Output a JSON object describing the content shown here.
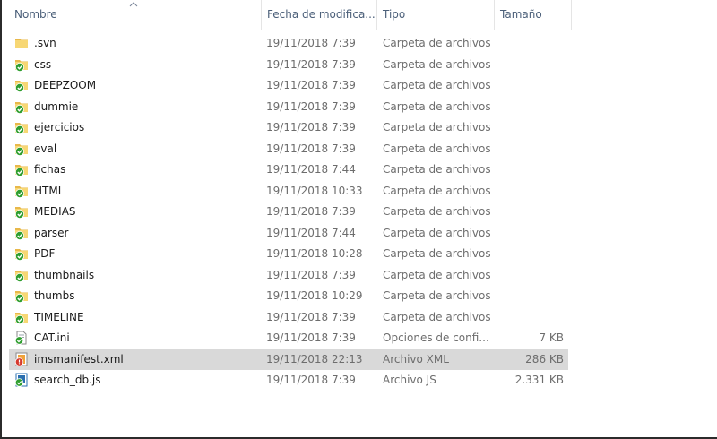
{
  "columns": {
    "name": "Nombre",
    "date": "Fecha de modifica...",
    "type": "Tipo",
    "size": "Tamaño"
  },
  "rows": [
    {
      "name": ".svn",
      "date": "19/11/2018 7:39",
      "type": "Carpeta de archivos",
      "size": "",
      "icon": "folder-icon"
    },
    {
      "name": "css",
      "date": "19/11/2018 7:39",
      "type": "Carpeta de archivos",
      "size": "",
      "icon": "folder-synced-icon"
    },
    {
      "name": "DEEPZOOM",
      "date": "19/11/2018 7:39",
      "type": "Carpeta de archivos",
      "size": "",
      "icon": "folder-synced-icon"
    },
    {
      "name": "dummie",
      "date": "19/11/2018 7:39",
      "type": "Carpeta de archivos",
      "size": "",
      "icon": "folder-synced-icon"
    },
    {
      "name": "ejercicios",
      "date": "19/11/2018 7:39",
      "type": "Carpeta de archivos",
      "size": "",
      "icon": "folder-synced-icon"
    },
    {
      "name": "eval",
      "date": "19/11/2018 7:39",
      "type": "Carpeta de archivos",
      "size": "",
      "icon": "folder-synced-icon"
    },
    {
      "name": "fichas",
      "date": "19/11/2018 7:44",
      "type": "Carpeta de archivos",
      "size": "",
      "icon": "folder-synced-icon"
    },
    {
      "name": "HTML",
      "date": "19/11/2018 10:33",
      "type": "Carpeta de archivos",
      "size": "",
      "icon": "folder-synced-icon"
    },
    {
      "name": "MEDIAS",
      "date": "19/11/2018 7:39",
      "type": "Carpeta de archivos",
      "size": "",
      "icon": "folder-synced-icon"
    },
    {
      "name": "parser",
      "date": "19/11/2018 7:44",
      "type": "Carpeta de archivos",
      "size": "",
      "icon": "folder-synced-icon"
    },
    {
      "name": "PDF",
      "date": "19/11/2018 10:28",
      "type": "Carpeta de archivos",
      "size": "",
      "icon": "folder-synced-icon"
    },
    {
      "name": "thumbnails",
      "date": "19/11/2018 7:39",
      "type": "Carpeta de archivos",
      "size": "",
      "icon": "folder-synced-icon"
    },
    {
      "name": "thumbs",
      "date": "19/11/2018 10:29",
      "type": "Carpeta de archivos",
      "size": "",
      "icon": "folder-synced-icon"
    },
    {
      "name": "TIMELINE",
      "date": "19/11/2018 7:39",
      "type": "Carpeta de archivos",
      "size": "",
      "icon": "folder-synced-icon"
    },
    {
      "name": "CAT.ini",
      "date": "19/11/2018 7:39",
      "type": "Opciones de confi...",
      "size": "7 KB",
      "icon": "ini-file-synced-icon"
    },
    {
      "name": "imsmanifest.xml",
      "date": "19/11/2018 22:13",
      "type": "Archivo XML",
      "size": "286 KB",
      "icon": "xml-file-modified-icon"
    },
    {
      "name": "search_db.js",
      "date": "19/11/2018 7:39",
      "type": "Archivo JS",
      "size": "2.331 KB",
      "icon": "js-file-synced-icon"
    }
  ],
  "selected_row": "imsmanifest.xml",
  "colors": {
    "header_text": "#4c607a",
    "selected_row": "#d9d9d9",
    "folder": "#f7d774",
    "synced_badge": "#2f9e2f",
    "modified_badge": "#d63a2f"
  }
}
